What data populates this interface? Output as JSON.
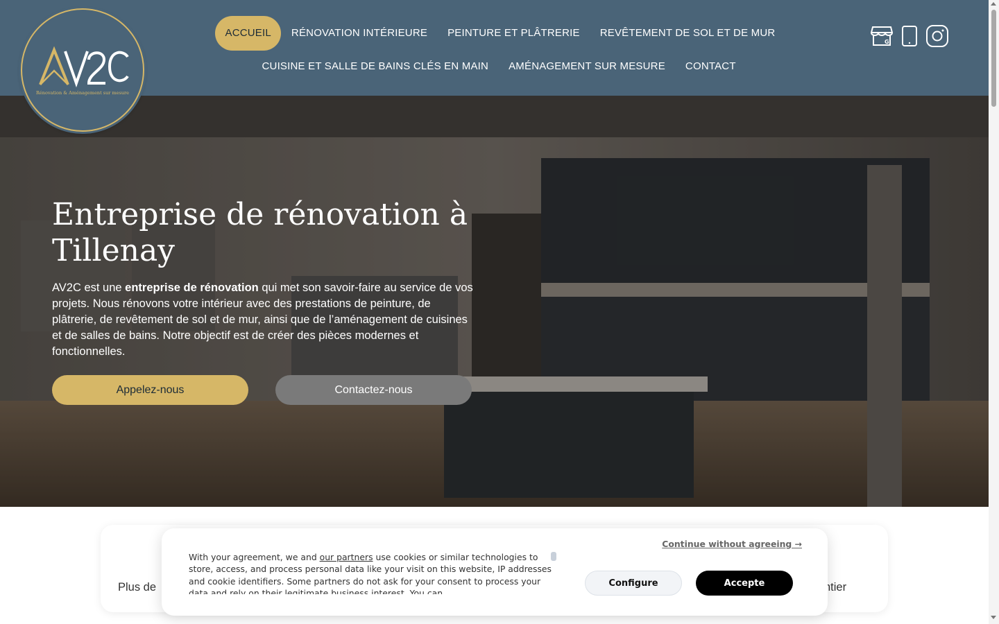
{
  "header": {
    "logo": {
      "text": "AV2C",
      "tagline": "Rénovation & Aménagement sur mesure"
    },
    "nav_row1": [
      {
        "label": "ACCUEIL",
        "active": true
      },
      {
        "label": "RÉNOVATION INTÉRIEURE",
        "active": false
      },
      {
        "label": "PEINTURE ET PLÂTRERIE",
        "active": false
      },
      {
        "label": "REVÊTEMENT DE SOL ET DE MUR",
        "active": false
      }
    ],
    "nav_row2": [
      {
        "label": "CUISINE ET SALLE DE BAINS CLÉS EN MAIN",
        "active": false
      },
      {
        "label": "AMÉNAGEMENT SUR MESURE",
        "active": false
      },
      {
        "label": "CONTACT",
        "active": false
      }
    ],
    "icons": [
      "google-business-icon",
      "phone-icon",
      "instagram-icon"
    ]
  },
  "hero": {
    "title": "Entreprise de rénovation à Tillenay",
    "text_prefix": "AV2C est une ",
    "text_bold": "entreprise de rénovation",
    "text_suffix": " qui met son savoir-faire au service de vos projets. Nous rénovons votre intérieur avec des prestations de peinture, de plâtrerie, de revêtement de sol et de mur, ainsi que de l’aménagement de cuisines et de salles de bains. Notre objectif est de créer des pièces modernes et fonctionnelles.",
    "btn_call": "Appelez-nous",
    "btn_contact": "Contactez-nous"
  },
  "features": {
    "left_text": "Plus de",
    "right_text": "ntier"
  },
  "cookie": {
    "text_before_link": "With your agreement, we and ",
    "link": "our partners",
    "text_after_link": " use cookies or similar technologies to store, access, and process personal data like your visit on this website, IP addresses and cookie identifiers. Some partners do not ask for your consent to process your data and rely on their legitimate business interest. You can",
    "continue": "Continue without agreeing →",
    "configure": "Configure",
    "accept": "Accepte"
  },
  "colors": {
    "header_bg": "#4a6478",
    "accent_gold": "#d6b767",
    "contact_btn": "#7a7a7a"
  }
}
